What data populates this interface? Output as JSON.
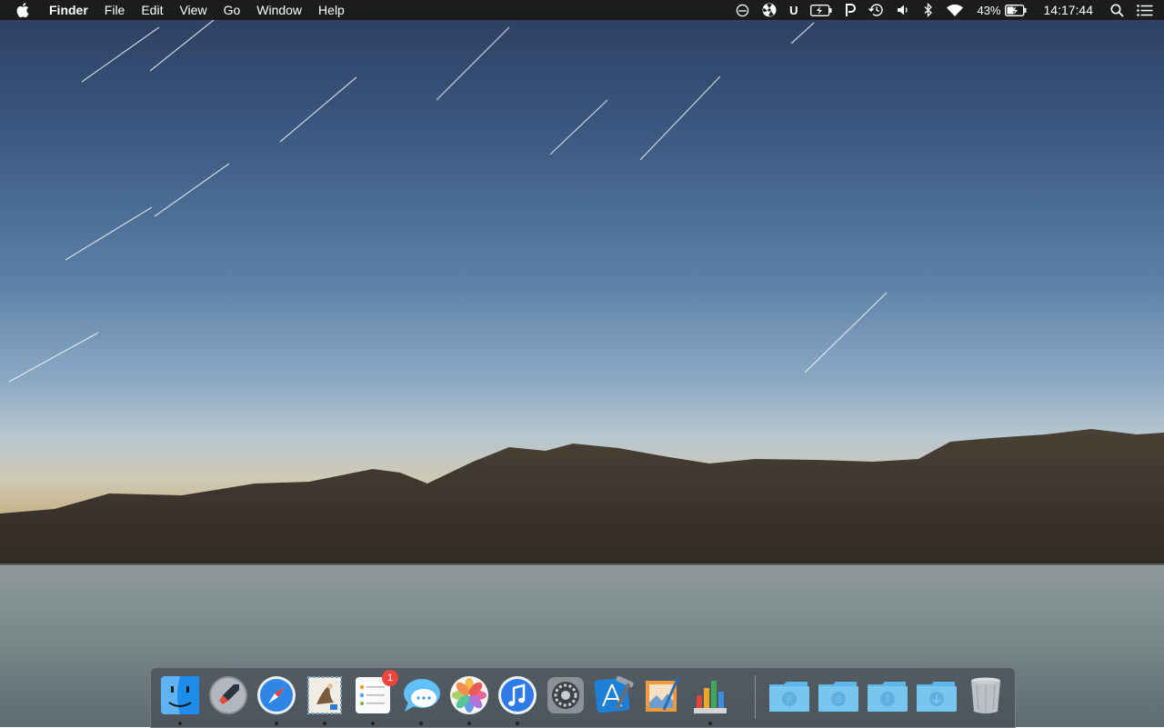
{
  "menubar": {
    "apple_icon": "apple-icon",
    "app_name": "Finder",
    "menus": [
      "File",
      "Edit",
      "View",
      "Go",
      "Window",
      "Help"
    ],
    "status": {
      "battery_percent": "43%",
      "time": "14:17:44",
      "u_label": "U",
      "icons": [
        "sync-icon",
        "radiation-icon",
        "u-icon",
        "battery-charging-icon",
        "p-icon",
        "time-machine-icon",
        "volume-icon",
        "bluetooth-icon",
        "wifi-icon",
        "battery-icon",
        "spotlight-icon",
        "notification-center-icon"
      ]
    }
  },
  "dock": {
    "apps": [
      {
        "name": "Finder",
        "icon": "finder-icon",
        "running": true
      },
      {
        "name": "Launchpad",
        "icon": "launchpad-icon",
        "running": false
      },
      {
        "name": "Safari",
        "icon": "safari-icon",
        "running": true
      },
      {
        "name": "Mail",
        "icon": "mail-icon",
        "running": true
      },
      {
        "name": "Reminders",
        "icon": "reminders-icon",
        "running": true,
        "badge": "1"
      },
      {
        "name": "Messages",
        "icon": "messages-icon",
        "running": true
      },
      {
        "name": "Photos",
        "icon": "photos-icon",
        "running": true
      },
      {
        "name": "iTunes",
        "icon": "itunes-icon",
        "running": true
      },
      {
        "name": "System Preferences",
        "icon": "system-preferences-icon",
        "running": false
      },
      {
        "name": "Xcode",
        "icon": "xcode-icon",
        "running": false
      },
      {
        "name": "Preview",
        "icon": "preview-icon",
        "running": false
      },
      {
        "name": "Numbers",
        "icon": "numbers-icon",
        "running": true
      }
    ],
    "folders": [
      {
        "letter": "F",
        "icon": "folder-f-icon"
      },
      {
        "letter": "S",
        "icon": "folder-s-icon"
      },
      {
        "letter": "T",
        "icon": "folder-t-icon"
      },
      {
        "letter": "",
        "icon": "downloads-folder-icon"
      }
    ],
    "trash": {
      "icon": "trash-icon"
    }
  },
  "colors": {
    "menubar": "#1c1c1e",
    "badge": "#f0453a",
    "folder": "#6fc3ec"
  }
}
